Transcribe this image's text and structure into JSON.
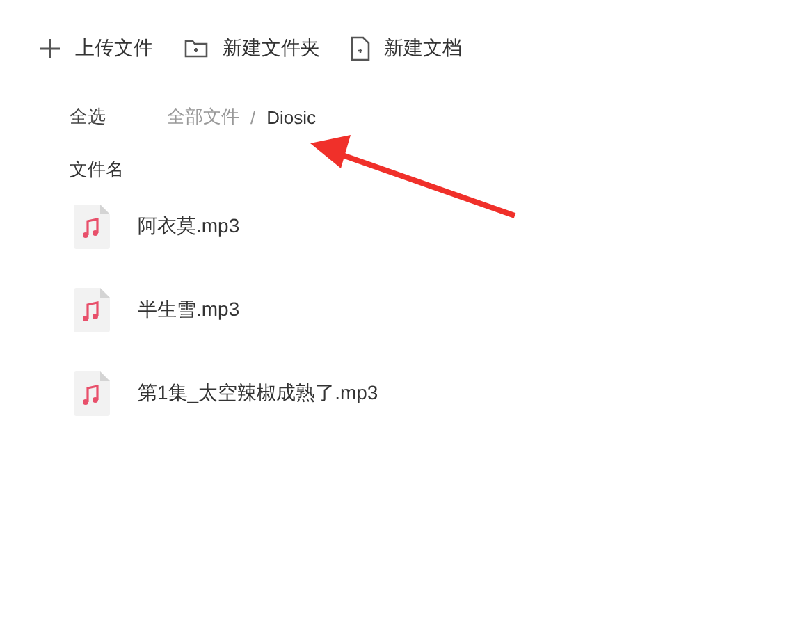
{
  "toolbar": [
    {
      "kind": "upload",
      "label": "上传文件"
    },
    {
      "kind": "folder",
      "label": "新建文件夹"
    },
    {
      "kind": "document",
      "label": "新建文档"
    }
  ],
  "select_all": "全选",
  "breadcrumb": {
    "separator": "/",
    "items": [
      {
        "label": "全部文件",
        "current": false
      },
      {
        "label": "Diosic",
        "current": true
      }
    ]
  },
  "column_header": "文件名",
  "files": [
    {
      "name": "阿衣莫.mp3"
    },
    {
      "name": "半生雪.mp3"
    },
    {
      "name": "第1集_太空辣椒成熟了.mp3"
    }
  ]
}
